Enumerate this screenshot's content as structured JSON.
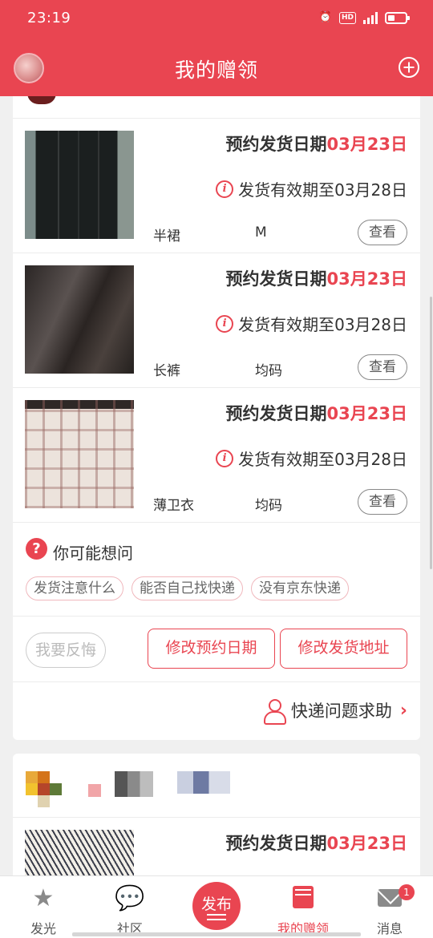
{
  "status_bar": {
    "time": "23:19",
    "hd": "HD",
    "network": "4G"
  },
  "header": {
    "title": "我的赠领"
  },
  "items": [
    {
      "date_prefix": "预约发货日期",
      "date": "03月23日",
      "valid": "发货有效期至03月28日",
      "name": "半裙",
      "size": "M",
      "view": "查看",
      "thumb": "skirt"
    },
    {
      "date_prefix": "预约发货日期",
      "date": "03月23日",
      "valid": "发货有效期至03月28日",
      "name": "长裤",
      "size": "均码",
      "view": "查看",
      "thumb": "pants"
    },
    {
      "date_prefix": "预约发货日期",
      "date": "03月23日",
      "valid": "发货有效期至03月28日",
      "name": "薄卫衣",
      "size": "均码",
      "view": "查看",
      "thumb": "coat"
    }
  ],
  "faq": {
    "icon": "?",
    "title": "你可能想问",
    "tags": [
      "发货注意什么",
      "能否自己找快递",
      "没有京东快递"
    ]
  },
  "actions": {
    "regret": "我要反悔",
    "modify_date": "修改预约日期",
    "modify_address": "修改发货地址"
  },
  "help": {
    "label": "快递问题求助"
  },
  "card2": {
    "item": {
      "date_prefix": "预约发货日期",
      "date": "03月23日"
    }
  },
  "bottom_nav": {
    "items": [
      {
        "label": "发光",
        "icon": "star-icon"
      },
      {
        "label": "社区",
        "icon": "chat-icon"
      },
      {
        "label": "我的赠领",
        "icon": "gift-icon",
        "active": true
      },
      {
        "label": "消息",
        "icon": "mail-icon",
        "badge": "1"
      }
    ],
    "publish": "发布"
  },
  "colors": {
    "accent": "#e94551",
    "background": "#f0f0f0"
  }
}
